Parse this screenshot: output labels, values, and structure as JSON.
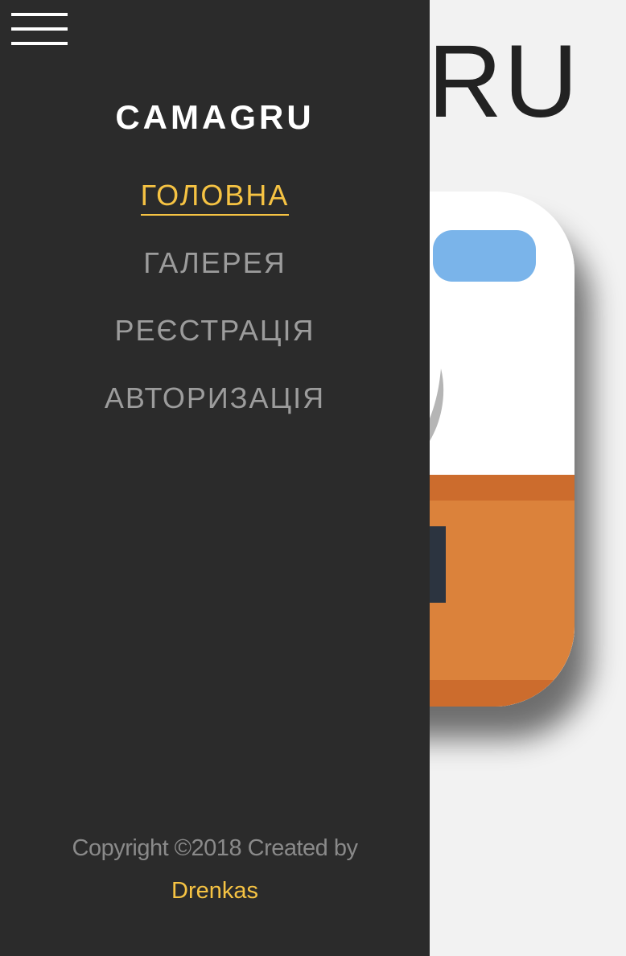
{
  "background": {
    "title_visible_fragment": "GRU"
  },
  "drawer": {
    "menu_icon": "hamburger-icon",
    "brand": "CAMAGRU",
    "nav": [
      {
        "label": "ГОЛОВНА",
        "active": true
      },
      {
        "label": "ГАЛЕРЕЯ",
        "active": false
      },
      {
        "label": "РЕЄСТРАЦІЯ",
        "active": false
      },
      {
        "label": "АВТОРИЗАЦІЯ",
        "active": false
      }
    ],
    "footer": {
      "copyright": "Copyright ©2018 Created by",
      "author": "Drenkas"
    }
  },
  "colors": {
    "drawer_bg": "#2b2b2b",
    "accent": "#f6c343",
    "nav_inactive": "#9c9c9c",
    "page_bg": "#f2f2f2",
    "logo_orange": "#db823b",
    "logo_dark_orange": "#cc6c2d",
    "logo_blue": "#7ab4ea"
  }
}
